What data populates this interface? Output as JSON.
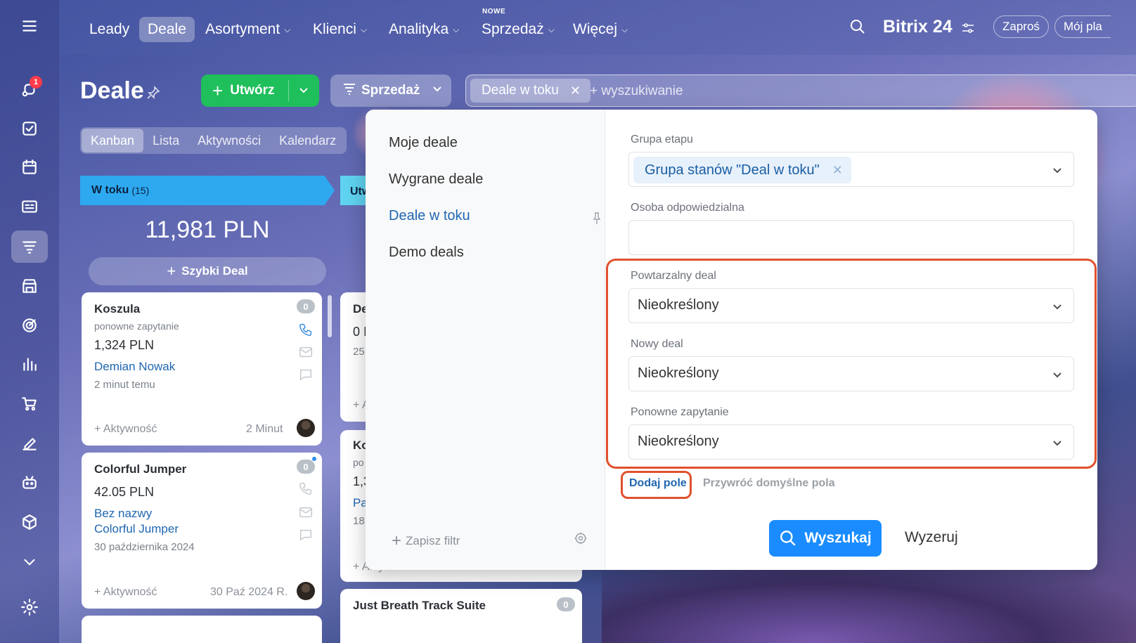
{
  "top_nav": {
    "items": [
      {
        "label": "Leady"
      },
      {
        "label": "Deale"
      },
      {
        "label": "Asortyment"
      },
      {
        "label": "Klienci"
      },
      {
        "label": "Analityka"
      },
      {
        "label": "Sprzedaż"
      },
      {
        "label": "Więcej"
      }
    ],
    "nowe_badge": "NOWE",
    "brand": "Bitrix 24",
    "invite": "Zaproś",
    "my_plan": "Mój pla"
  },
  "rail": {
    "notification_count": "1"
  },
  "page": {
    "title": "Deale",
    "create_label": "Utwórz",
    "pipeline_label": "Sprzedaż",
    "search_chip": "Deale w toku",
    "search_placeholder": "+ wyszukiwanie",
    "view_tabs": [
      "Kanban",
      "Lista",
      "Aktywności",
      "Kalendarz"
    ]
  },
  "kanban": {
    "column1": {
      "name": "W toku",
      "count": "(15)",
      "sum": "11,981 PLN",
      "quick_deal": "Szybki Deal"
    },
    "column2": {
      "name": "Utw"
    },
    "cards": [
      {
        "title": "Koszula",
        "sub": "ponowne zapytanie",
        "price": "1,324 PLN",
        "link": "Demian Nowak",
        "time": "2 minut temu",
        "activity": "+ Aktywność",
        "date": "2 Minut",
        "count": "0"
      },
      {
        "title": "Colorful Jumper",
        "price": "42.05 PLN",
        "link": "Bez nazwy",
        "link2": "Colorful Jumper",
        "time": "30 października 2024",
        "activity": "+ Aktywność",
        "date": "30 Paź 2024 R.",
        "count": "0"
      },
      {
        "title": "Just Breath Track Suite",
        "count": "0"
      }
    ],
    "partial_cards": [
      {
        "title": "De",
        "line1": "0 I",
        "line2": "25",
        "activity": "+ A"
      },
      {
        "title": "Ko",
        "line1": "po",
        "line2": "1,3",
        "link": "Pa",
        "line3": "18",
        "activity": "+ Aktywność"
      }
    ]
  },
  "filter_popup": {
    "presets": [
      "Moje deale",
      "Wygrane deale",
      "Deale w toku",
      "Demo deals"
    ],
    "active_preset": "Deale w toku",
    "save_filter": "Zapisz filtr",
    "fields": {
      "stage_group": {
        "label": "Grupa etapu",
        "tag": "Grupa stanów \"Deal w toku\""
      },
      "responsible": {
        "label": "Osoba odpowiedzialna",
        "value": ""
      },
      "recurring": {
        "label": "Powtarzalny deal",
        "value": "Nieokreślony"
      },
      "new_deal": {
        "label": "Nowy deal",
        "value": "Nieokreślony"
      },
      "repeat_inquiry": {
        "label": "Ponowne zapytanie",
        "value": "Nieokreślony"
      }
    },
    "add_field": "Dodaj pole",
    "restore_defaults": "Przywróć domyślne pola",
    "search_button": "Wyszukaj",
    "reset_button": "Wyzeruj"
  },
  "colors": {
    "accent_blue": "#1a8cff",
    "create_green": "#1fbf5c",
    "highlight_red": "#e0512d",
    "column_blue": "#2ea9f0"
  }
}
